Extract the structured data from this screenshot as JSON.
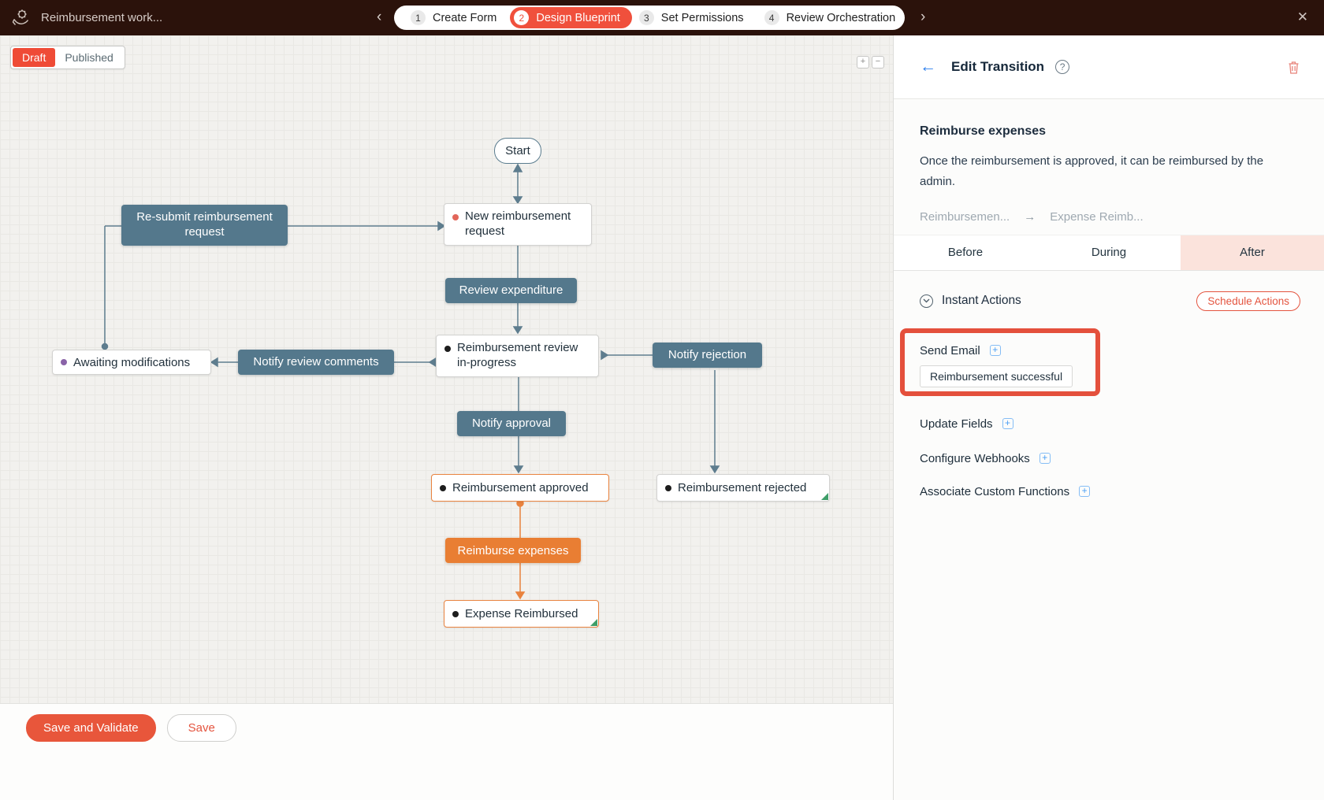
{
  "topbar": {
    "title": "Reimbursement work...",
    "prev_icon": "‹",
    "next_icon": "›",
    "close_icon": "✕",
    "steps": [
      {
        "num": "1",
        "label": "Create Form",
        "active": false
      },
      {
        "num": "2",
        "label": "Design Blueprint",
        "active": true
      },
      {
        "num": "3",
        "label": "Set Permissions",
        "active": false
      },
      {
        "num": "4",
        "label": "Review Orchestration",
        "active": false
      }
    ],
    "active_step_color": "#f0503c"
  },
  "canvas": {
    "mode_toggle": {
      "draft": "Draft",
      "published": "Published",
      "draft_color": "#ef4b36"
    },
    "zoom": {
      "in": "+",
      "out": "−"
    },
    "footer": {
      "save_validate": "Save and Validate",
      "save": "Save"
    },
    "workflow": {
      "colors": {
        "slate": "#54788c",
        "orange": "#e97e33",
        "arrow": "#5e7d8e",
        "orange_arrow": "#e9833f",
        "fold_green": "#3f9e69",
        "state_dot_red": "#e2665a",
        "state_dot_purple": "#8a63a8",
        "state_dot_black": "#1d1d1d"
      },
      "start": {
        "label": "Start"
      },
      "nodes": {
        "new_request": {
          "label": "New reimbursement request",
          "type": "state"
        },
        "resubmit": {
          "label": "Re-submit reimbursement request",
          "type": "transition"
        },
        "review_expenditure": {
          "label": "Review expenditure",
          "type": "transition"
        },
        "review_inprogress": {
          "label": "Reimbursement review in-progress",
          "type": "state"
        },
        "notify_comments": {
          "label": "Notify review comments",
          "type": "transition"
        },
        "awaiting": {
          "label": "Awaiting modifications",
          "type": "state"
        },
        "notify_rejection": {
          "label": "Notify rejection",
          "type": "transition"
        },
        "notify_approval": {
          "label": "Notify approval",
          "type": "transition"
        },
        "approved": {
          "label": "Reimbursement approved",
          "type": "state"
        },
        "rejected": {
          "label": "Reimbursement rejected",
          "type": "state"
        },
        "reimburse": {
          "label": "Reimburse expenses",
          "type": "transition"
        },
        "reimbursed": {
          "label": "Expense Reimbursed",
          "type": "state"
        }
      }
    }
  },
  "panel": {
    "header": {
      "title": "Edit Transition",
      "back_icon": "←",
      "help_icon": "?"
    },
    "transition": {
      "name": "Reimburse expenses",
      "description": "Once the reimbursement is approved, it can be reimbursed by the admin.",
      "from": "Reimbursemen...",
      "arrow": "→",
      "to": "Expense Reimb..."
    },
    "tabs": [
      {
        "label": "Before",
        "active": false
      },
      {
        "label": "During",
        "active": false
      },
      {
        "label": "After",
        "active": true
      }
    ],
    "actions": {
      "instant_title": "Instant Actions",
      "schedule_button": "Schedule Actions",
      "plus_icon": "+",
      "items": [
        {
          "label": "Send Email",
          "value": "Reimbursement successful",
          "highlighted": true
        },
        {
          "label": "Update Fields"
        },
        {
          "label": "Configure Webhooks"
        },
        {
          "label": "Associate Custom Functions"
        }
      ],
      "highlight_color": "#e4503c"
    }
  }
}
